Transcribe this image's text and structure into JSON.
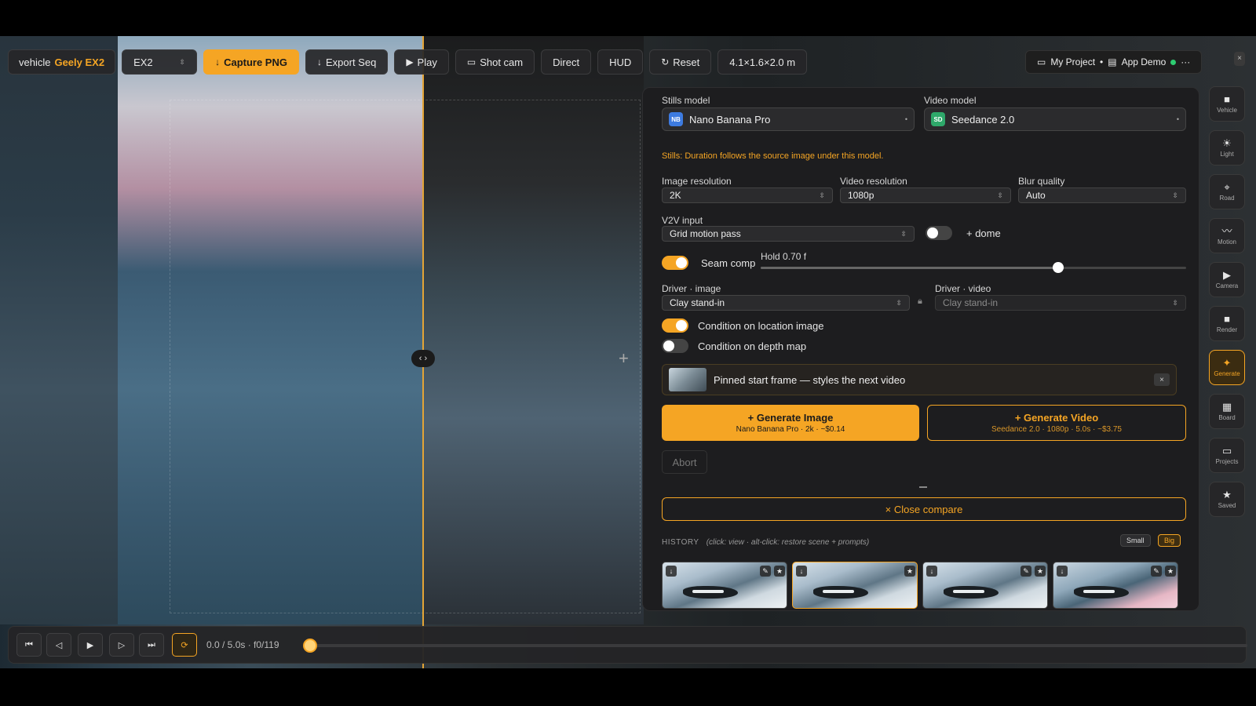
{
  "toolbar": {
    "vehicle_prefix": "vehicle",
    "vehicle_name": "Geely EX2",
    "model_select": "EX2",
    "capture_png": "Capture PNG",
    "export_seq": "Export Seq",
    "play": "Play",
    "shot_cam": "Shot cam",
    "direct": "Direct",
    "hud": "HUD",
    "reset": "Reset",
    "dimensions": "4.1×1.6×2.0 m"
  },
  "project": {
    "project_name": "My Project",
    "separator": "•",
    "app_name": "App Demo",
    "more": "···",
    "status_color": "#2ecc71"
  },
  "rail": [
    {
      "label": "Vehicle",
      "icon": "square-icon"
    },
    {
      "label": "Light",
      "icon": "sun-icon"
    },
    {
      "label": "Road",
      "icon": "crosshair-icon"
    },
    {
      "label": "Motion",
      "icon": "wave-icon"
    },
    {
      "label": "Camera",
      "icon": "play-icon"
    },
    {
      "label": "Render",
      "icon": "square-icon"
    },
    {
      "label": "Generate",
      "icon": "sparkle-icon",
      "active": true
    },
    {
      "label": "Board",
      "icon": "film-icon"
    },
    {
      "label": "Projects",
      "icon": "folder-icon"
    },
    {
      "label": "Saved",
      "icon": "star-icon"
    }
  ],
  "panel": {
    "stills_model_label": "Stills model",
    "stills_model_badge": "NB",
    "stills_model_value": "Nano Banana Pro",
    "video_model_label": "Video model",
    "video_model_badge": "SD",
    "video_model_value": "Seedance 2.0",
    "note": "Stills: Duration follows the source image under this model.",
    "image_resolution_label": "Image resolution",
    "image_resolution_value": "2K",
    "video_resolution_label": "Video resolution",
    "video_resolution_value": "1080p",
    "blur_quality_label": "Blur quality",
    "blur_quality_value": "Auto",
    "v2v_label": "V2V input",
    "v2v_value": "Grid motion pass",
    "dome_label": "+ dome",
    "dome_on": false,
    "seam_comp_label": "Seam comp",
    "seam_comp_on": true,
    "hold_label": "Hold 0.70 f",
    "hold_fraction": 0.7,
    "driver_image_label": "Driver · image",
    "driver_image_value": "Clay stand-in",
    "driver_video_label": "Driver · video",
    "driver_video_value": "Clay stand-in",
    "cond_location_label": "Condition on location image",
    "cond_location_on": true,
    "cond_depth_label": "Condition on depth map",
    "cond_depth_on": false,
    "pinned_text": "Pinned start frame — styles the next video",
    "pinned_close": "×",
    "gen_image_title": "+ Generate Image",
    "gen_image_sub": "Nano Banana Pro · 2k · ~$0.14",
    "gen_video_title": "+ Generate Video",
    "gen_video_sub": "Seedance 2.0 · 1080p · 5.0s · ~$3.75",
    "abort": "Abort",
    "close_compare": "× Close compare",
    "history_label": "HISTORY",
    "history_hint": "(click: view · alt-click: restore scene + prompts)",
    "size_small": "Small",
    "size_big": "Big"
  },
  "transport": {
    "time": "0.0 / 5.0s · f0/119",
    "playhead_fraction": 0.0
  },
  "colors": {
    "accent": "#f5a524",
    "panel_bg": "#1d1d1f"
  }
}
